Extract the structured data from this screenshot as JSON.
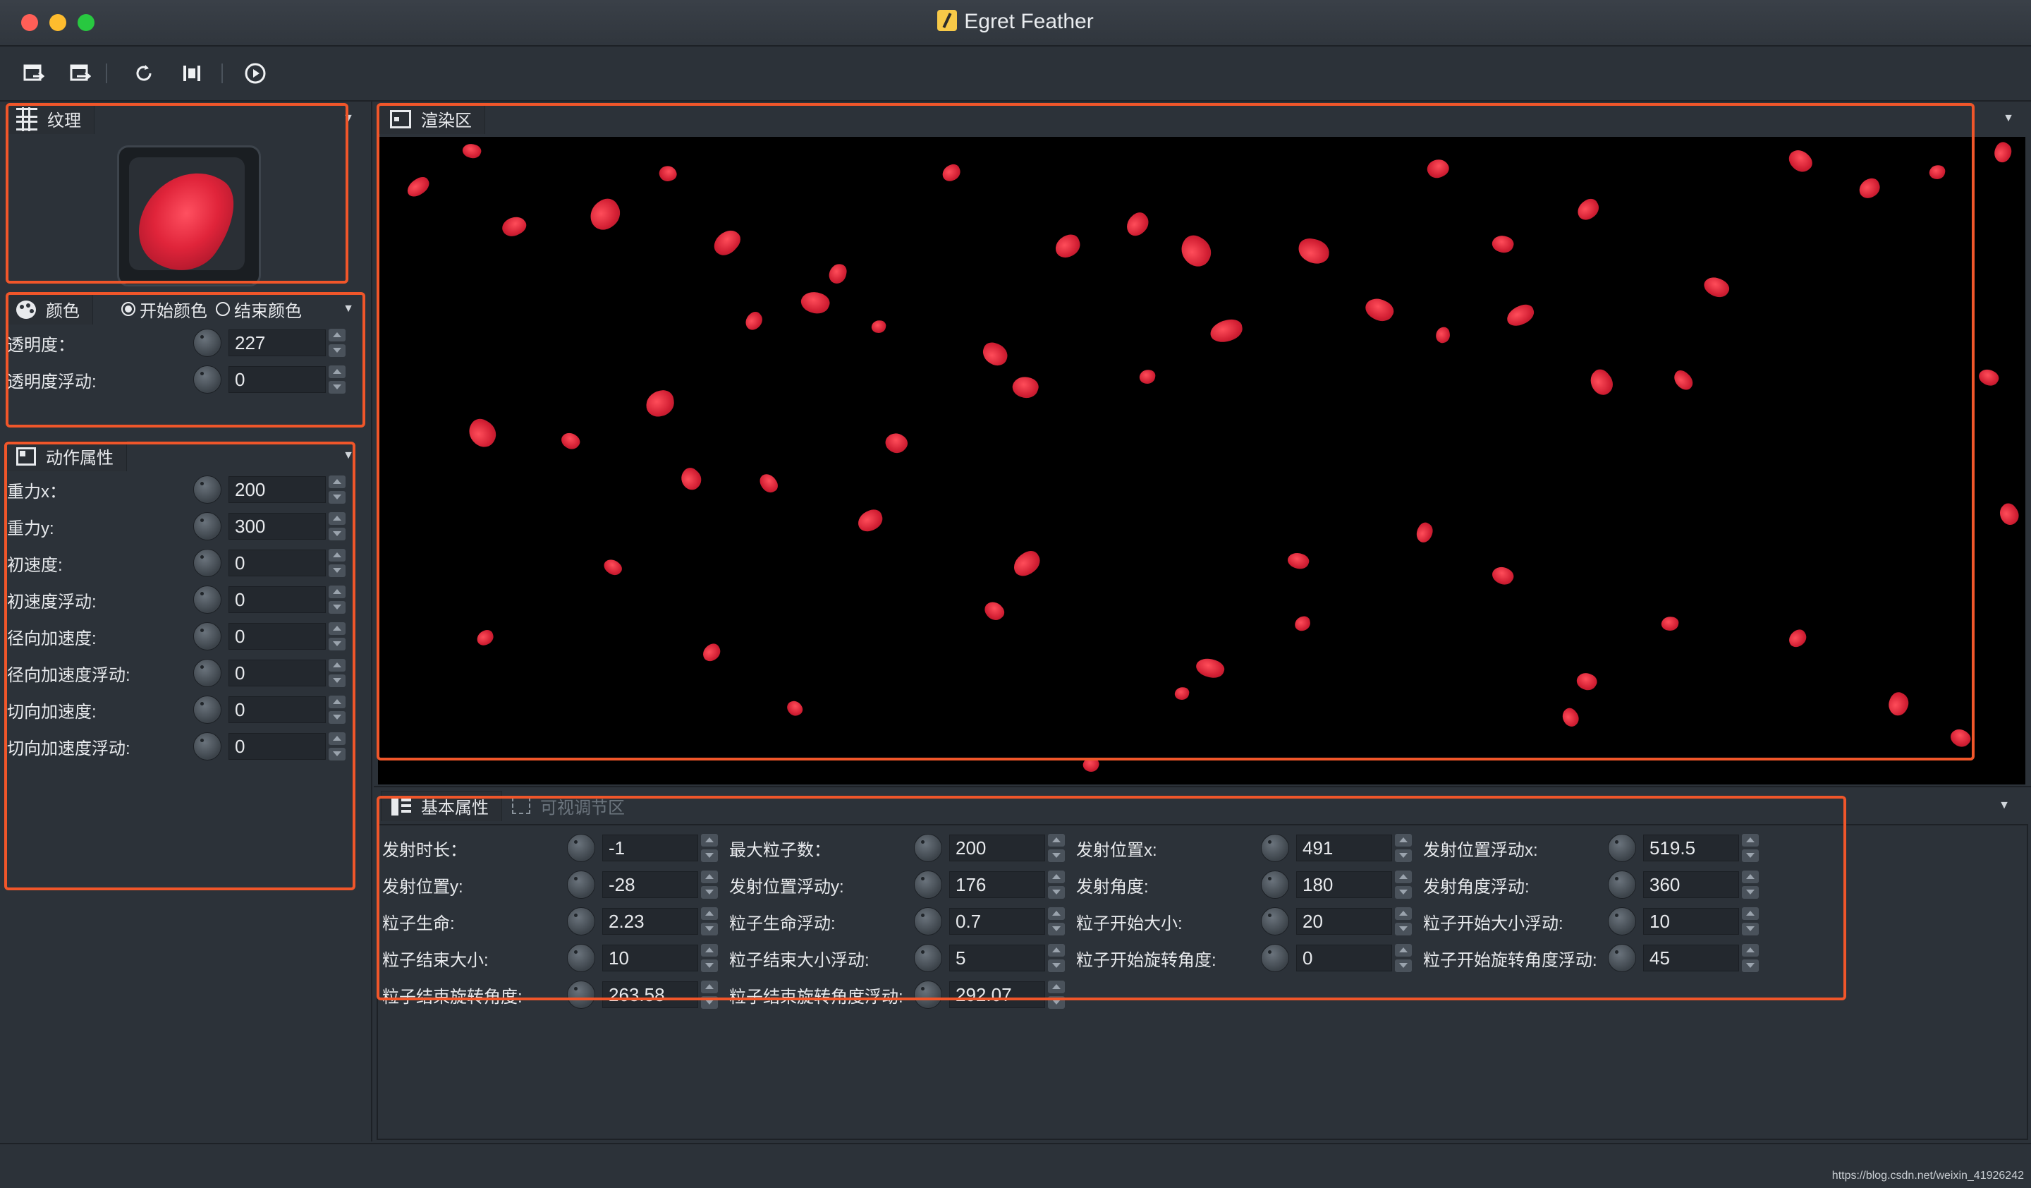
{
  "window": {
    "title": "Egret Feather"
  },
  "toolbar": {
    "buttons": [
      {
        "icon": "import-icon"
      },
      {
        "icon": "export-icon"
      },
      {
        "icon": "refresh-icon"
      },
      {
        "icon": "fit-icon"
      },
      {
        "icon": "play-icon"
      }
    ]
  },
  "texture_panel": {
    "title": "纹理"
  },
  "color_panel": {
    "title": "颜色",
    "radio_start": "开始颜色",
    "radio_end": "结束颜色",
    "selected": "开始颜色",
    "rows": [
      {
        "label": "透明度：",
        "value": "227"
      },
      {
        "label": "透明度浮动:",
        "value": "0"
      }
    ]
  },
  "motion_panel": {
    "title": "动作属性",
    "rows": [
      {
        "label": "重力x：",
        "value": "200"
      },
      {
        "label": "重力y:",
        "value": "300"
      },
      {
        "label": "初速度:",
        "value": "0"
      },
      {
        "label": "初速度浮动:",
        "value": "0"
      },
      {
        "label": "径向加速度:",
        "value": "0"
      },
      {
        "label": "径向加速度浮动:",
        "value": "0"
      },
      {
        "label": "切向加速度:",
        "value": "0"
      },
      {
        "label": "切向加速度浮动:",
        "value": "0"
      }
    ]
  },
  "render_panel": {
    "title": "渲染区"
  },
  "bottom_panel": {
    "tab_basic": "基本属性",
    "tab_visual": "可视调节区",
    "rows": [
      [
        {
          "label": "发射时长：",
          "value": "-1"
        },
        {
          "label": "最大粒子数：",
          "value": "200"
        },
        {
          "label": "发射位置x:",
          "value": "491"
        },
        {
          "label": "发射位置浮动x:",
          "value": "519.5"
        }
      ],
      [
        {
          "label": "发射位置y:",
          "value": "-28"
        },
        {
          "label": "发射位置浮动y:",
          "value": "176"
        },
        {
          "label": "发射角度:",
          "value": "180"
        },
        {
          "label": "发射角度浮动:",
          "value": "360"
        }
      ],
      [
        {
          "label": "粒子生命:",
          "value": "2.23"
        },
        {
          "label": "粒子生命浮动:",
          "value": "0.7"
        },
        {
          "label": "粒子开始大小:",
          "value": "20"
        },
        {
          "label": "粒子开始大小浮动:",
          "value": "10"
        }
      ],
      [
        {
          "label": "粒子结束大小:",
          "value": "10"
        },
        {
          "label": "粒子结束大小浮动:",
          "value": "5"
        },
        {
          "label": "粒子开始旋转角度:",
          "value": "0"
        },
        {
          "label": "粒子开始旋转角度浮动:",
          "value": "45"
        }
      ],
      [
        {
          "label": "粒子结束旋转角度:",
          "value": "263.58"
        },
        {
          "label": "粒子结束旋转角度浮动:",
          "value": "292.07"
        }
      ]
    ]
  },
  "status": {
    "watermark": "https://blog.csdn.net/weixin_41926242"
  },
  "colors": {
    "highlight": "#f0562a",
    "petal": "#d21f33",
    "canvas": "#000000"
  }
}
